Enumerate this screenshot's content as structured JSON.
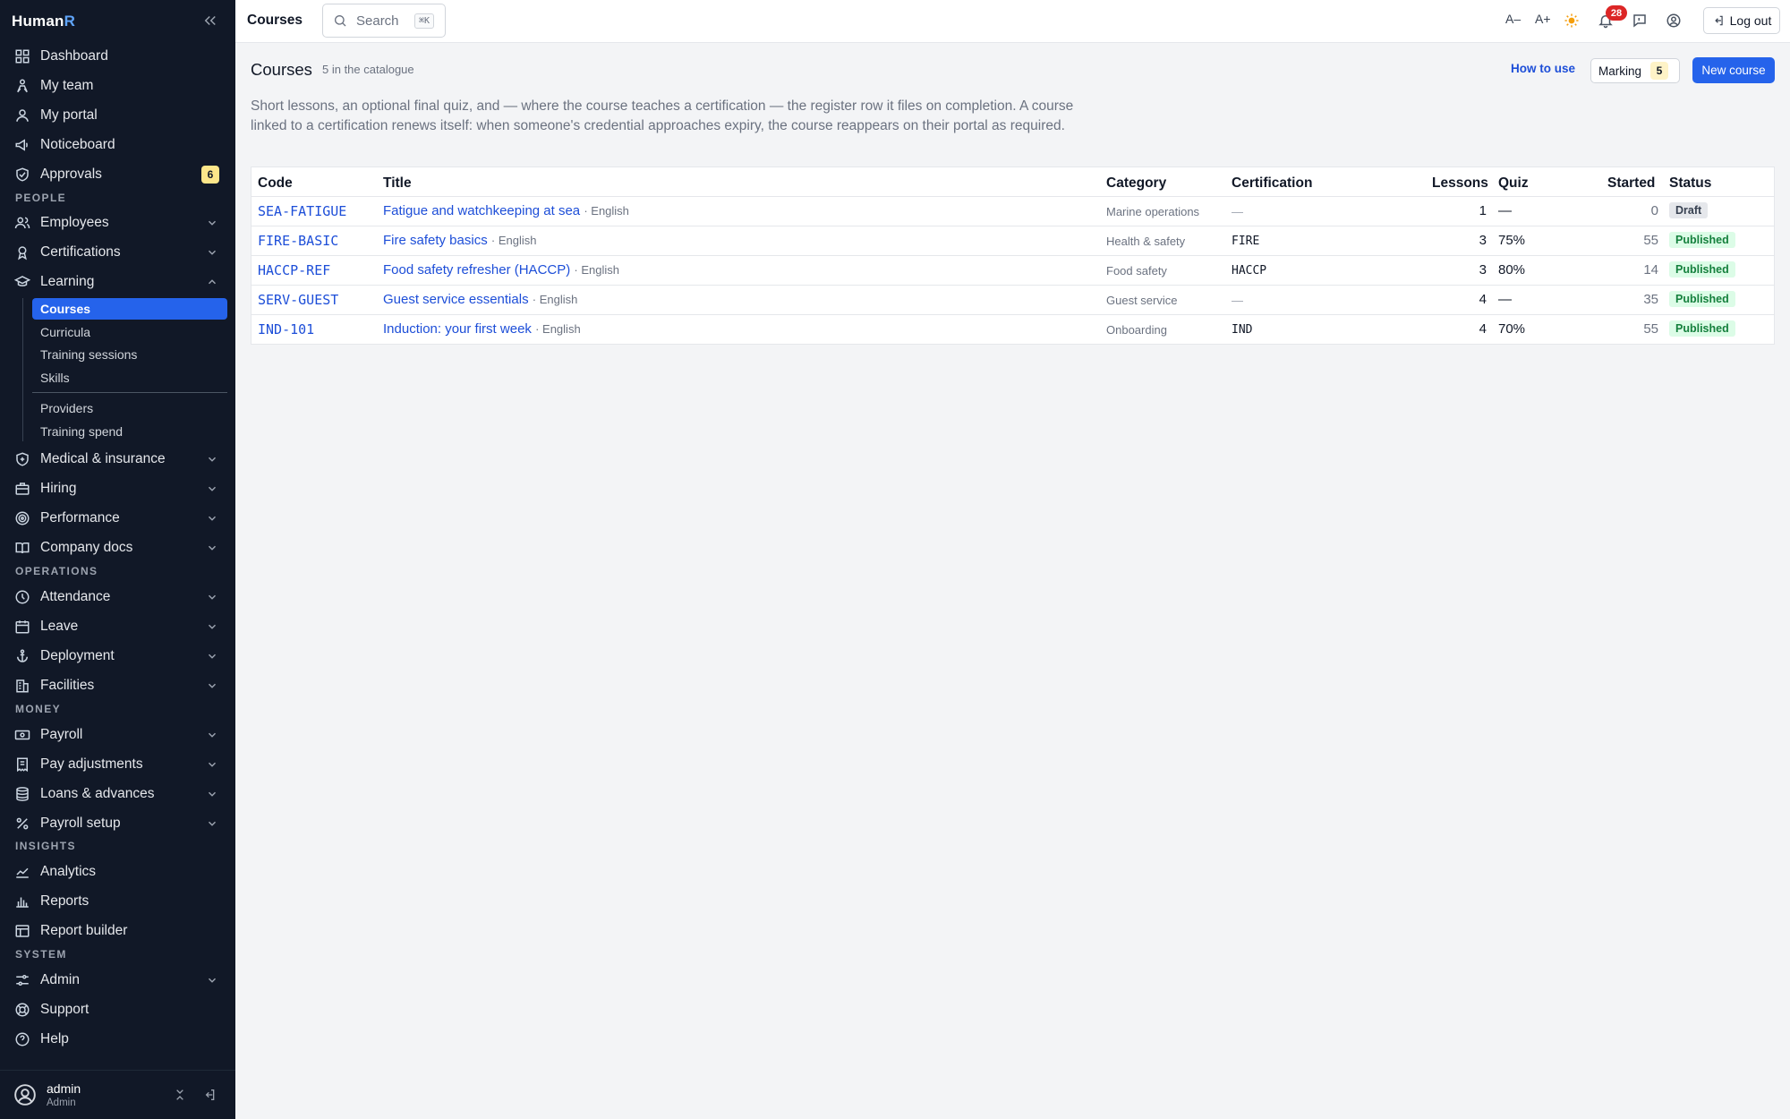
{
  "brand": {
    "name_a": "Human",
    "name_b": "R"
  },
  "nav": {
    "dashboard": "Dashboard",
    "my_team": "My team",
    "my_portal": "My portal",
    "noticeboard": "Noticeboard",
    "approvals": "Approvals",
    "approvals_count": "6",
    "section_people": "PEOPLE",
    "employees": "Employees",
    "certifications": "Certifications",
    "learning": "Learning",
    "learning_sub": {
      "courses": "Courses",
      "curricula": "Curricula",
      "training_sessions": "Training sessions",
      "skills": "Skills",
      "providers": "Providers",
      "training_spend": "Training spend"
    },
    "medical": "Medical & insurance",
    "hiring": "Hiring",
    "performance": "Performance",
    "company_docs": "Company docs",
    "section_operations": "OPERATIONS",
    "attendance": "Attendance",
    "leave": "Leave",
    "deployment": "Deployment",
    "facilities": "Facilities",
    "section_money": "MONEY",
    "payroll": "Payroll",
    "pay_adjustments": "Pay adjustments",
    "loans": "Loans & advances",
    "payroll_setup": "Payroll setup",
    "section_insights": "INSIGHTS",
    "analytics": "Analytics",
    "reports": "Reports",
    "report_builder": "Report builder",
    "section_system": "SYSTEM",
    "admin": "Admin",
    "support": "Support",
    "help": "Help"
  },
  "user": {
    "name": "admin",
    "role": "Admin"
  },
  "topbar": {
    "title": "Courses",
    "search_placeholder": "Search",
    "search_shortcut": "⌘K",
    "font_smaller": "A–",
    "font_larger": "A+",
    "notifications_count": "28",
    "logout": "Log out"
  },
  "page": {
    "title": "Courses",
    "subtitle": "5 in the catalogue",
    "how_to_use": "How to use",
    "marking_label": "Marking",
    "marking_count": "5",
    "new_course": "New course",
    "description": "Short lessons, an optional final quiz, and — where the course teaches a certification — the register row it files on completion. A course linked to a certification renews itself: when someone's credential approaches expiry, the course reappears on their portal as required."
  },
  "table": {
    "headers": {
      "code": "Code",
      "title": "Title",
      "category": "Category",
      "certification": "Certification",
      "lessons": "Lessons",
      "quiz": "Quiz",
      "started": "Started",
      "status": "Status"
    },
    "rows": [
      {
        "code": "SEA-FATIGUE",
        "title": "Fatigue and watchkeeping at sea",
        "lang": "· English",
        "category": "Marine operations",
        "certification": "—",
        "lessons": "1",
        "quiz": "—",
        "started": "0",
        "status": "Draft"
      },
      {
        "code": "FIRE-BASIC",
        "title": "Fire safety basics",
        "lang": "· English",
        "category": "Health & safety",
        "certification": "FIRE",
        "lessons": "3",
        "quiz": "75%",
        "started": "55",
        "status": "Published"
      },
      {
        "code": "HACCP-REF",
        "title": "Food safety refresher (HACCP)",
        "lang": "· English",
        "category": "Food safety",
        "certification": "HACCP",
        "lessons": "3",
        "quiz": "80%",
        "started": "14",
        "status": "Published"
      },
      {
        "code": "SERV-GUEST",
        "title": "Guest service essentials",
        "lang": "· English",
        "category": "Guest service",
        "certification": "—",
        "lessons": "4",
        "quiz": "—",
        "started": "35",
        "status": "Published"
      },
      {
        "code": "IND-101",
        "title": "Induction: your first week",
        "lang": "· English",
        "category": "Onboarding",
        "certification": "IND",
        "lessons": "4",
        "quiz": "70%",
        "started": "55",
        "status": "Published"
      }
    ]
  }
}
